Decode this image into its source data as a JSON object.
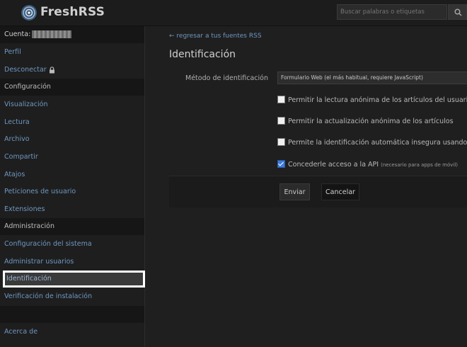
{
  "header": {
    "app_name": "FreshRSS",
    "search_placeholder": "Buscar palabras o etiquetas"
  },
  "sidebar": {
    "account_label": "Cuenta:",
    "items": [
      {
        "label": "Perfil"
      },
      {
        "label": "Desconectar"
      },
      {
        "label": "Configuración",
        "section": true
      },
      {
        "label": "Visualización"
      },
      {
        "label": "Lectura"
      },
      {
        "label": "Archivo"
      },
      {
        "label": "Compartir"
      },
      {
        "label": "Atajos"
      },
      {
        "label": "Peticiones de usuario"
      },
      {
        "label": "Extensiones"
      },
      {
        "label": "Administración",
        "section": true
      },
      {
        "label": "Configuración del sistema"
      },
      {
        "label": "Administrar usuarios"
      },
      {
        "label": "Identificación",
        "active": true
      },
      {
        "label": "Verificación de instalación"
      },
      {
        "label": "Acerca de"
      }
    ]
  },
  "main": {
    "back_link": "← regresar a tus fuentes RSS",
    "title": "Identificación",
    "method_label": "Método de identificación",
    "method_value": "Formulario Web (el más habitual, requiere JavaScript)",
    "checkboxes": [
      {
        "label": "Permitir la lectura anónima de los artículos del usuario p",
        "checked": false
      },
      {
        "label": "Permitir la actualización anónima de los artículos",
        "checked": false
      },
      {
        "label": "Permite la identificación automática insegura usando el",
        "checked": false
      },
      {
        "label": "Concederle acceso a la API",
        "note": "(necesario para apps de móvil)",
        "checked": true
      }
    ],
    "submit_label": "Enviar",
    "cancel_label": "Cancelar"
  }
}
